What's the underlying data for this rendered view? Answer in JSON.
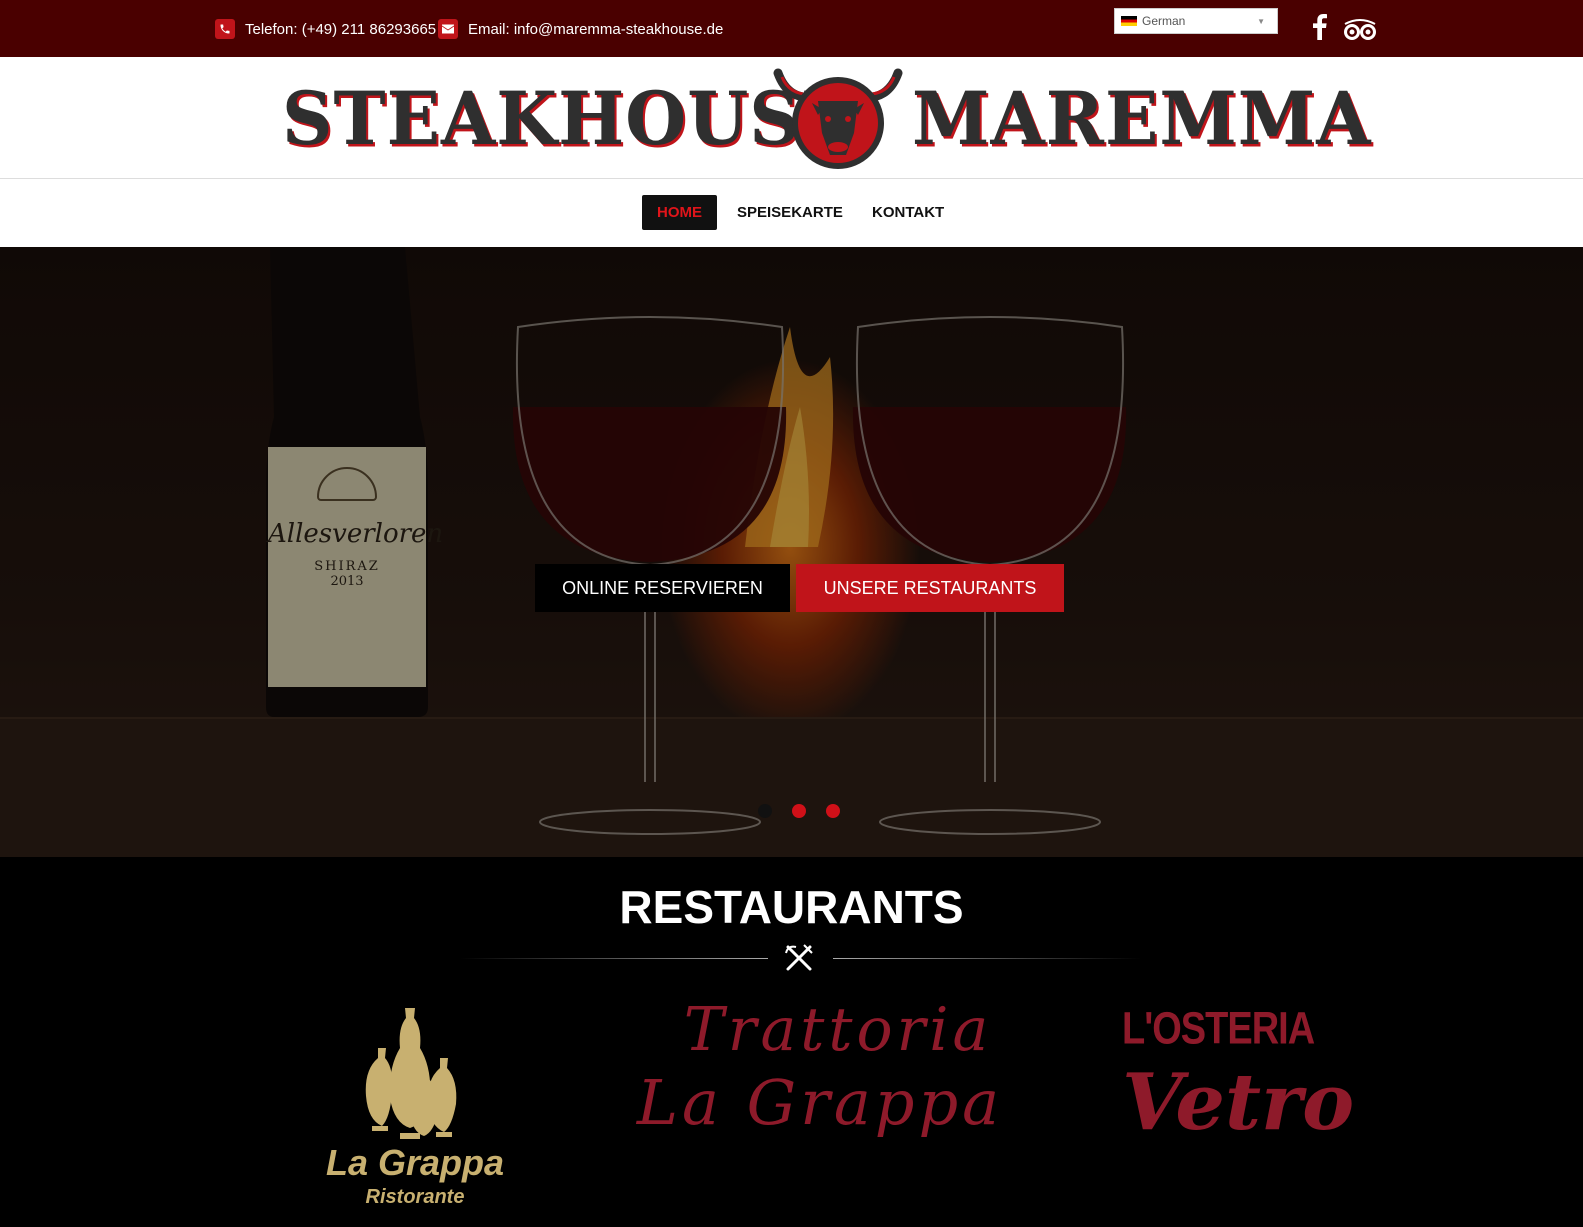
{
  "topbar": {
    "phone": "Telefon: (+49) 211 86293665",
    "email": "Email: info@maremma-steakhouse.de",
    "language": "German"
  },
  "logo": {
    "left": "STEAKHOUSE",
    "right": "MAREMMA"
  },
  "nav": {
    "items": [
      "HOME",
      "SPEISEKARTE",
      "KONTAKT"
    ],
    "active": "HOME"
  },
  "hero": {
    "buttons": [
      "ONLINE RESERVIEREN",
      "UNSERE RESTAURANTS"
    ],
    "bottle_label": [
      "Allesverloren",
      "SHIRAZ",
      "2013"
    ],
    "slides": 3,
    "active_slide": 1
  },
  "restaurants": {
    "title": "RESTAURANTS",
    "logos": [
      {
        "line1": "La Grappa",
        "line2": "Ristorante"
      },
      {
        "line1": "Trattoria",
        "line2": "La Grappa"
      },
      {
        "line1": "L'OSTERIA",
        "line2": "Vetro"
      }
    ]
  },
  "colors": {
    "topbar": "#4a0000",
    "accent": "#c0141a",
    "gold": "#c8b070",
    "wine": "#8e1a2a"
  }
}
